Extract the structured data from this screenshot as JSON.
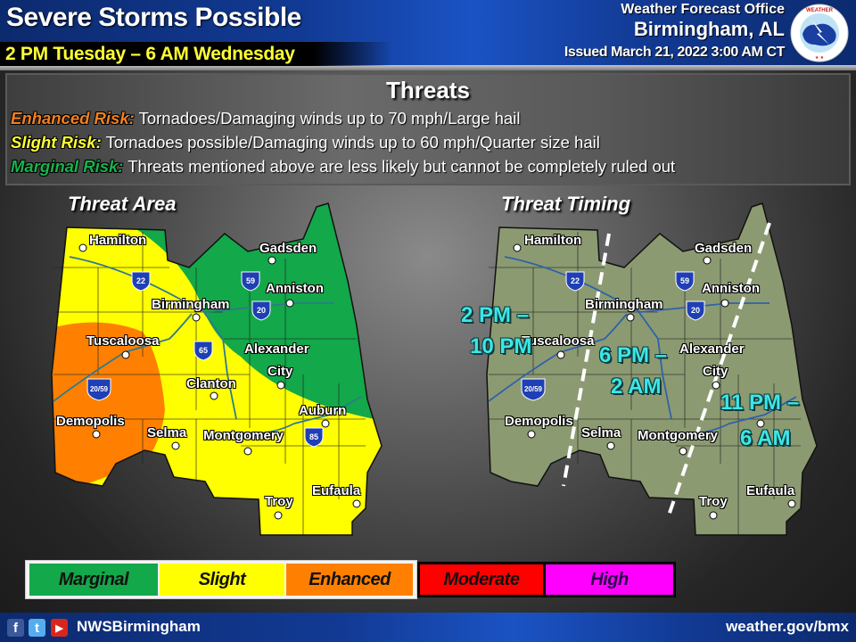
{
  "header": {
    "title": "Severe Storms Possible",
    "subtitle": "2 PM Tuesday – 6 AM Wednesday",
    "office_line1": "Weather Forecast Office",
    "office_line2": "Birmingham, AL",
    "issued": "Issued March 21, 2022 3:00 AM CT",
    "logo_icon": "nws-logo-icon"
  },
  "threats": {
    "title": "Threats",
    "items": [
      {
        "label": "Enhanced Risk:",
        "text": " Tornadoes/Damaging winds up to 70 mph/Large hail",
        "color": "#f08020"
      },
      {
        "label": "Slight Risk:",
        "text": " Tornadoes possible/Damaging winds up to 60 mph/Quarter size hail",
        "color": "#ffff33"
      },
      {
        "label": "Marginal Risk:",
        "text": " Threats mentioned above are less likely but cannot be completely ruled out",
        "color": "#19b34c"
      }
    ]
  },
  "threat_area_map": {
    "title": "Threat Area",
    "cities": [
      "Hamilton",
      "Gadsden",
      "Anniston",
      "Birmingham",
      "Tuscaloosa",
      "Alexander City",
      "Clanton",
      "Auburn",
      "Demopolis",
      "Selma",
      "Montgomery",
      "Troy",
      "Eufaula"
    ],
    "interstates": [
      "22",
      "59",
      "20",
      "65",
      "20/59",
      "85"
    ],
    "risk_regions": [
      {
        "category": "Marginal",
        "area": "northeast and east-central Alabama (Gadsden, Anniston, Birmingham east, Alexander City)"
      },
      {
        "category": "Slight",
        "area": "northwest, central and southeast Alabama (Hamilton, Clanton, Selma, Montgomery, Auburn, Troy, Eufaula)"
      },
      {
        "category": "Enhanced",
        "area": "west-central Alabama (Tuscaloosa southwest, Demopolis)"
      }
    ]
  },
  "threat_timing_map": {
    "title": "Threat Timing",
    "cities": [
      "Hamilton",
      "Gadsden",
      "Anniston",
      "Birmingham",
      "Tuscaloosa",
      "Alexander City",
      "Clanton",
      "Auburn",
      "Demopolis",
      "Selma",
      "Montgomery",
      "Troy",
      "Eufaula"
    ],
    "windows": [
      {
        "line1": "2 PM –",
        "line2": "10 PM"
      },
      {
        "line1": "6 PM –",
        "line2": "2 AM"
      },
      {
        "line1": "11 PM –",
        "line2": "6 AM"
      }
    ]
  },
  "legend": [
    {
      "label": "Marginal",
      "color": "#13a84a"
    },
    {
      "label": "Slight",
      "color": "#ffff00"
    },
    {
      "label": "Enhanced",
      "color": "#ff8000"
    },
    {
      "label": "Moderate",
      "color": "#ff0000"
    },
    {
      "label": "High",
      "color": "#ff00ff"
    }
  ],
  "footer": {
    "social_icons": [
      "facebook-icon",
      "twitter-icon",
      "youtube-icon"
    ],
    "handle": "NWSBirmingham",
    "website": "weather.gov/bmx"
  },
  "colors": {
    "header_blue": "#123a94",
    "subtitle_yellow": "#ffff33",
    "timing_cyan": "#3ee6e6",
    "timing_map_fill": "#8c9a72"
  }
}
